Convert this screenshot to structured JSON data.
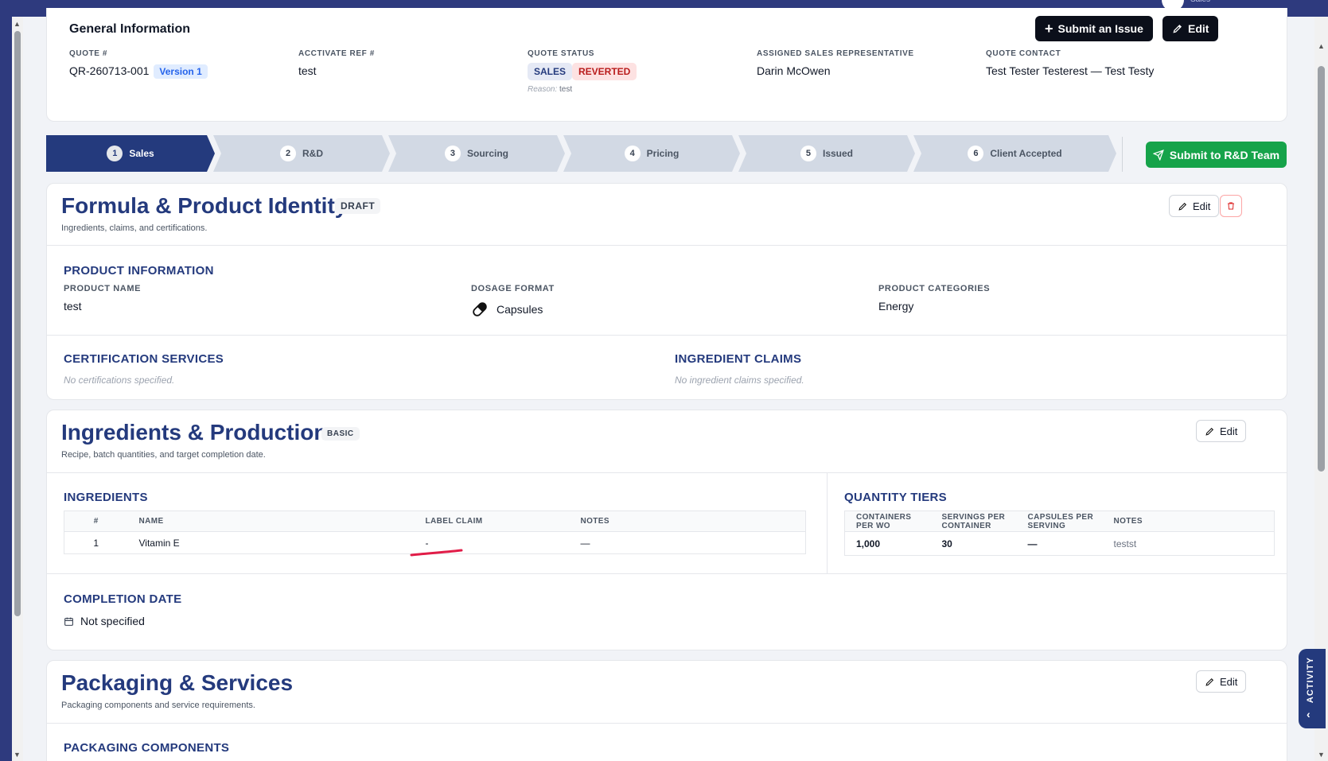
{
  "topbar": {
    "role": "Sales"
  },
  "general": {
    "title": "General Information",
    "submit_issue_label": "Submit an Issue",
    "edit_label": "Edit",
    "quote_no_label": "QUOTE #",
    "quote_no": "QR-260713-001",
    "version": "Version 1",
    "activate_ref_label": "ACCTIVATE REF #",
    "activate_ref": "test",
    "status_label": "QUOTE STATUS",
    "status_sales": "SALES",
    "status_reverted": "REVERTED",
    "reason_label": "Reason:",
    "reason": "test",
    "rep_label": "ASSIGNED SALES REPRESENTATIVE",
    "rep": "Darin McOwen",
    "contact_label": "QUOTE CONTACT",
    "contact": "Test Tester Testerest — Test Testy"
  },
  "steps": [
    {
      "num": "1",
      "label": "Sales"
    },
    {
      "num": "2",
      "label": "R&D"
    },
    {
      "num": "3",
      "label": "Sourcing"
    },
    {
      "num": "4",
      "label": "Pricing"
    },
    {
      "num": "5",
      "label": "Issued"
    },
    {
      "num": "6",
      "label": "Client Accepted"
    }
  ],
  "submit_rd_label": "Submit to R&D Team",
  "formula": {
    "title": "Formula & Product Identity",
    "tag": "DRAFT",
    "subtitle": "Ingredients, claims, and certifications.",
    "edit_label": "Edit",
    "product_info_title": "PRODUCT INFORMATION",
    "product_name_label": "PRODUCT NAME",
    "product_name": "test",
    "dosage_label": "DOSAGE FORMAT",
    "dosage": "Capsules",
    "categories_label": "PRODUCT CATEGORIES",
    "categories": "Energy",
    "cert_title": "CERTIFICATION SERVICES",
    "cert_empty": "No certifications specified.",
    "claims_title": "INGREDIENT CLAIMS",
    "claims_empty": "No ingredient claims specified."
  },
  "ingredients": {
    "title": "Ingredients & Production",
    "tag": "BASIC",
    "subtitle": "Recipe, batch quantities, and target completion date.",
    "edit_label": "Edit",
    "table_title": "INGREDIENTS",
    "headers": [
      "#",
      "NAME",
      "LABEL CLAIM",
      "NOTES"
    ],
    "rows": [
      {
        "num": "1",
        "name": "Vitamin E",
        "claim": "-",
        "notes": "—"
      }
    ],
    "tiers_title": "QUANTITY TIERS",
    "tier_headers": [
      "CONTAINERS PER WO",
      "SERVINGS PER CONTAINER",
      "CAPSULES PER SERVING",
      "NOTES"
    ],
    "tier_rows": [
      {
        "containers": "1,000",
        "servings": "30",
        "capsules": "—",
        "notes": "testst"
      }
    ],
    "completion_title": "COMPLETION DATE",
    "completion_value": "Not specified"
  },
  "packaging": {
    "title": "Packaging & Services",
    "subtitle": "Packaging components and service requirements.",
    "edit_label": "Edit",
    "components_title": "PACKAGING COMPONENTS"
  },
  "activity_label": "ACTIVITY",
  "colors": {
    "navy": "#243a7d",
    "green": "#16a34a",
    "step_inactive": "#d2d9e4",
    "danger": "#dc2626"
  }
}
